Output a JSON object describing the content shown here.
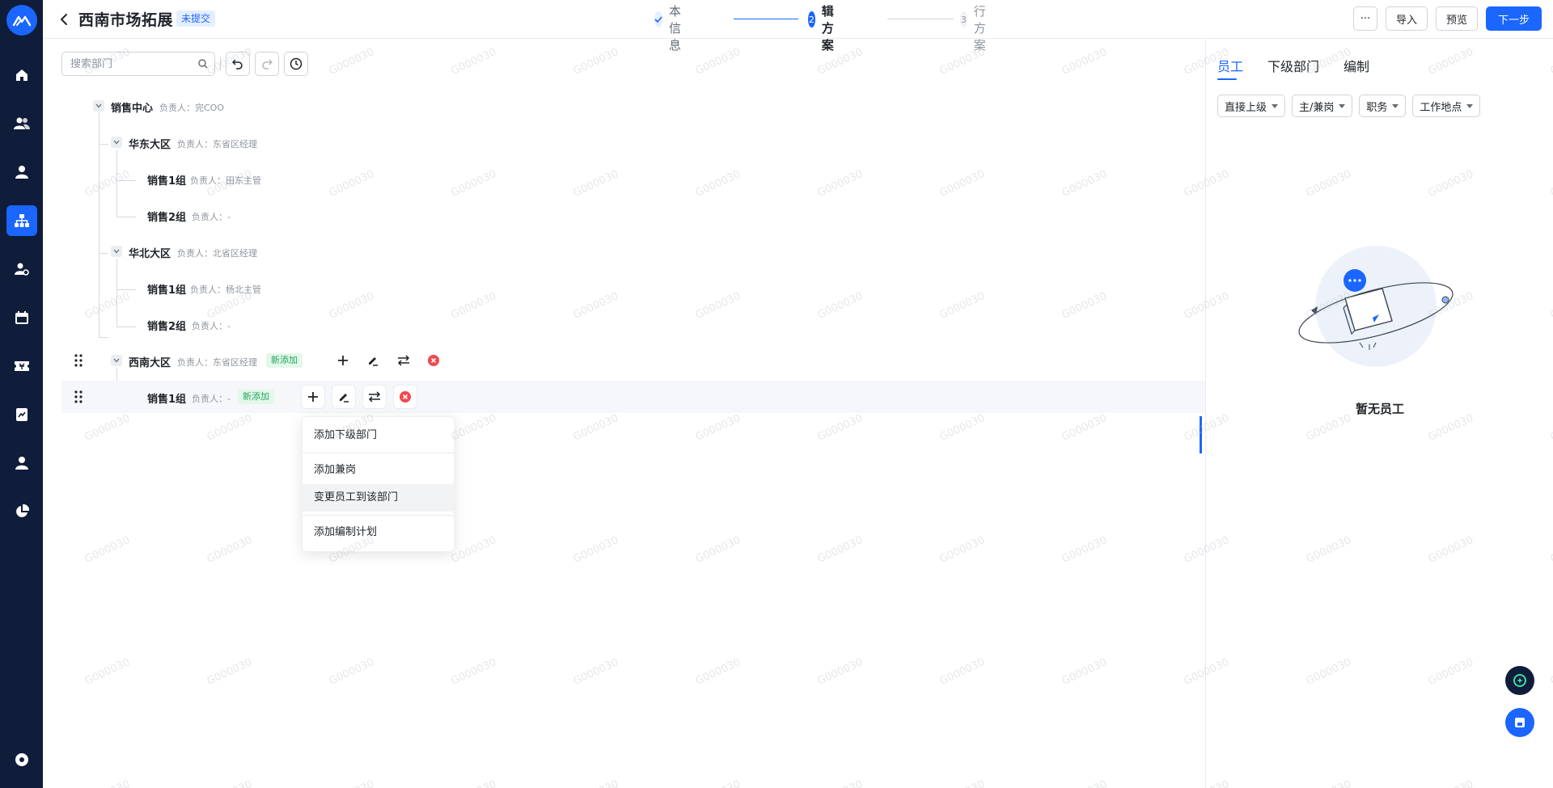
{
  "header": {
    "title": "西南市场拓展",
    "status": "未提交",
    "steps": [
      {
        "num": "✓",
        "label": "基本信息"
      },
      {
        "num": "2",
        "label": "编辑方案"
      },
      {
        "num": "3",
        "label": "执行方案"
      }
    ],
    "actions": {
      "more": "···",
      "import": "导入",
      "preview": "预览",
      "next": "下一步"
    }
  },
  "toolbar": {
    "search_placeholder": "搜索部门"
  },
  "tree": {
    "owner_prefix": "负责人：",
    "new_tag": "新添加",
    "nodes": [
      {
        "name": "销售中心",
        "owner": "完COO"
      },
      {
        "name": "华东大区",
        "owner": "东省区经理"
      },
      {
        "name": "销售1组",
        "owner": "田东主管"
      },
      {
        "name": "销售2组",
        "owner": "-"
      },
      {
        "name": "华北大区",
        "owner": "北省区经理"
      },
      {
        "name": "销售1组",
        "owner": "杨北主管"
      },
      {
        "name": "销售2组",
        "owner": "-"
      },
      {
        "name": "西南大区",
        "owner": "东省区经理"
      },
      {
        "name": "销售1组",
        "owner": "-"
      }
    ]
  },
  "context_menu": {
    "items": [
      "添加下级部门",
      "添加兼岗",
      "变更员工到该部门",
      "添加编制计划"
    ]
  },
  "right_panel": {
    "tabs": [
      "员工",
      "下级部门",
      "编制"
    ],
    "filters": [
      "直接上级",
      "主/兼岗",
      "职务",
      "工作地点"
    ],
    "empty_text": "暂无员工"
  },
  "watermark": "G000030",
  "colors": {
    "primary": "#1a66ff",
    "nav_bg": "#0f1c3a",
    "success": "#22a55b",
    "danger": "#f5484d"
  }
}
